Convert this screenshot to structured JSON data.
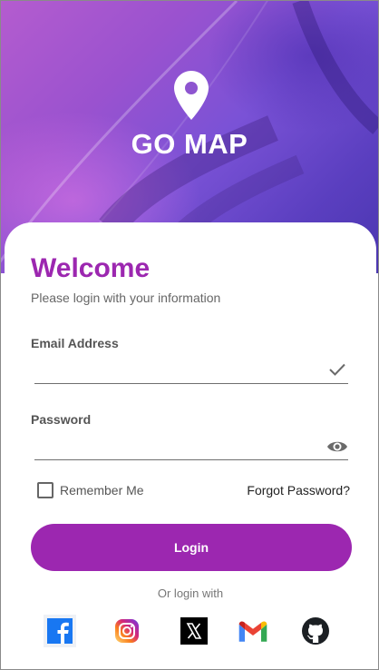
{
  "header": {
    "app_title": "GO MAP",
    "logo_icon": "location-pin-icon"
  },
  "login": {
    "welcome": "Welcome",
    "subtitle": "Please login with your information",
    "email_label": "Email Address",
    "email_value": "",
    "email_status_icon": "check-icon",
    "password_label": "Password",
    "password_value": "",
    "password_toggle_icon": "eye-icon",
    "remember_me": "Remember Me",
    "remember_checked": false,
    "forgot_password": "Forgot Password?",
    "login_button": "Login",
    "or_login_with": "Or login with"
  },
  "social": [
    {
      "name": "Facebook",
      "icon": "facebook-icon",
      "color": "#1877f2"
    },
    {
      "name": "Instagram",
      "icon": "instagram-icon",
      "color": "#e1306c"
    },
    {
      "name": "X",
      "icon": "x-icon",
      "color": "#000000"
    },
    {
      "name": "Gmail",
      "icon": "gmail-icon",
      "color": "#ea4335"
    },
    {
      "name": "GitHub",
      "icon": "github-icon",
      "color": "#1b1f23"
    }
  ],
  "colors": {
    "accent": "#9c27b0",
    "hero_start": "#b45ccf",
    "hero_end": "#4a36b0"
  }
}
